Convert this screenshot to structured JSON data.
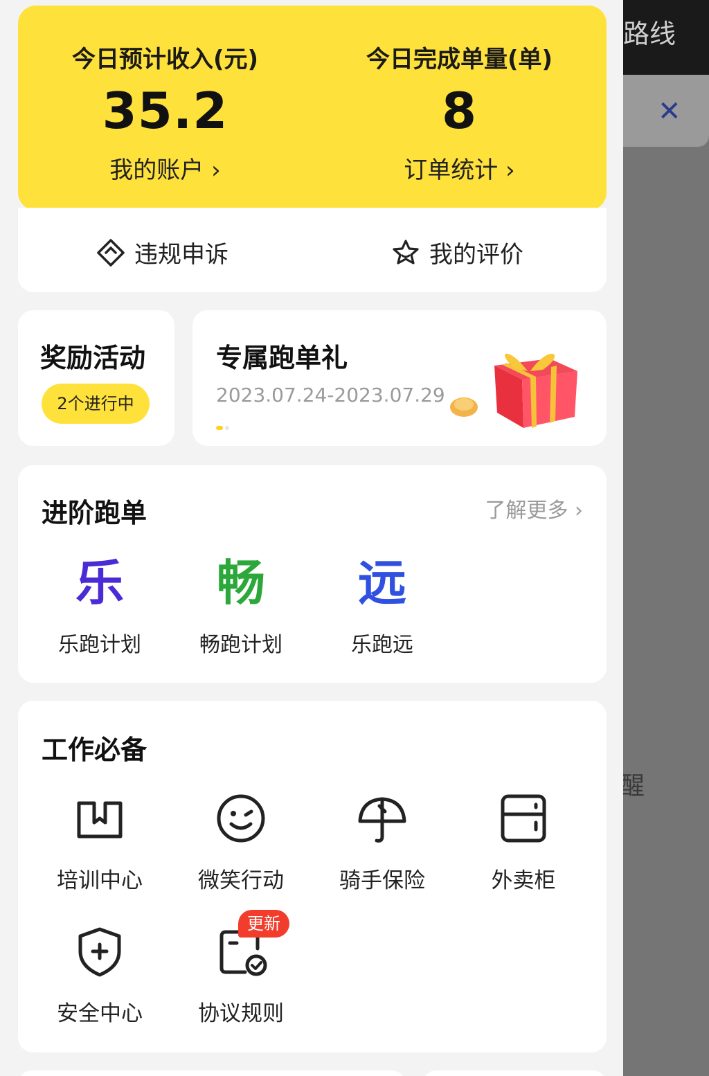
{
  "background": {
    "top_text": "路线",
    "close_icon": "close-icon",
    "remind_text": "醒"
  },
  "stats": {
    "income_label": "今日预计收入(元)",
    "income_value": "35.2",
    "account_link": "我的账户 ›",
    "orders_label": "今日完成单量(单)",
    "orders_value": "8",
    "orders_link": "订单统计 ›",
    "accent_color": "#ffe13c"
  },
  "quick_actions": [
    {
      "label": "违规申诉",
      "icon": "appeal-icon"
    },
    {
      "label": "我的评价",
      "icon": "star-icon"
    }
  ],
  "reward": {
    "title": "奖励活动",
    "badge": "2个进行中"
  },
  "promo": {
    "title": "专属跑单礼",
    "date_range": "2023.07.24-2023.07.29",
    "image": "gift-box-icon"
  },
  "advanced": {
    "title": "进阶跑单",
    "more_link": "了解更多",
    "plans": [
      {
        "glyph": "乐",
        "label": "乐跑计划",
        "color": "#4a2bd6"
      },
      {
        "glyph": "畅",
        "label": "畅跑计划",
        "color": "#2ca83a"
      },
      {
        "glyph": "远",
        "label": "乐跑远",
        "color": "#3050e0"
      }
    ]
  },
  "tools": {
    "title": "工作必备",
    "items": [
      {
        "label": "培训中心",
        "icon": "book-icon"
      },
      {
        "label": "微笑行动",
        "icon": "smile-icon"
      },
      {
        "label": "骑手保险",
        "icon": "umbrella-icon"
      },
      {
        "label": "外卖柜",
        "icon": "locker-icon"
      },
      {
        "label": "安全中心",
        "icon": "shield-icon"
      },
      {
        "label": "协议规则",
        "icon": "agreement-icon"
      }
    ],
    "new_badge": "更新"
  }
}
